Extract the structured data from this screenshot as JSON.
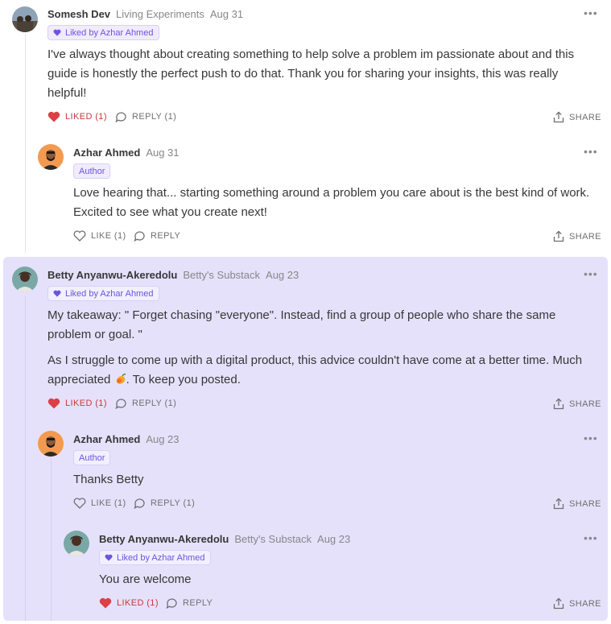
{
  "comments": [
    {
      "author": "Somesh Dev",
      "publication": "Living Experiments",
      "date": "Aug 31",
      "badge": "Liked by Azhar Ahmed",
      "paragraphs": [
        "I've always thought about creating something to help solve a problem im passionate about and this guide is honestly the perfect push to do that. Thank you for sharing your insights, this was really helpful!"
      ],
      "like_label": "LIKED (1)",
      "reply_label": "REPLY (1)",
      "share_label": "SHARE"
    },
    {
      "author": "Azhar Ahmed",
      "date": "Aug 31",
      "badge": "Author",
      "paragraphs": [
        "Love hearing that... starting something around a problem you care about is the best kind of work. Excited to see what you create next!"
      ],
      "like_label": "LIKE (1)",
      "reply_label": "REPLY",
      "share_label": "SHARE"
    },
    {
      "author": "Betty Anyanwu-Akeredolu",
      "publication": "Betty's Substack",
      "date": "Aug 23",
      "badge": "Liked by Azhar Ahmed",
      "paragraphs": [
        "My takeaway: \" Forget chasing \"everyone\". Instead, find a group of people who share the same problem or goal. \"",
        "As I struggle to come up with a digital product, this advice couldn't have come at a better time. Much appreciated",
        ". To keep you posted."
      ],
      "like_label": "LIKED (1)",
      "reply_label": "REPLY (1)",
      "share_label": "SHARE"
    },
    {
      "author": "Azhar Ahmed",
      "date": "Aug 23",
      "badge": "Author",
      "paragraphs": [
        "Thanks Betty"
      ],
      "like_label": "LIKE (1)",
      "reply_label": "REPLY (1)",
      "share_label": "SHARE"
    },
    {
      "author": "Betty Anyanwu-Akeredolu",
      "publication": "Betty's Substack",
      "date": "Aug 23",
      "badge": "Liked by Azhar Ahmed",
      "paragraphs": [
        "You are welcome"
      ],
      "like_label": "LIKED (1)",
      "reply_label": "REPLY",
      "share_label": "SHARE"
    }
  ],
  "colors": {
    "accent": "#6c55de",
    "liked": "#c9363e",
    "highlight": "#e6e1fb"
  },
  "icons": [
    "heart-icon",
    "reply-icon",
    "share-icon",
    "more-icon",
    "mango-emoji"
  ]
}
